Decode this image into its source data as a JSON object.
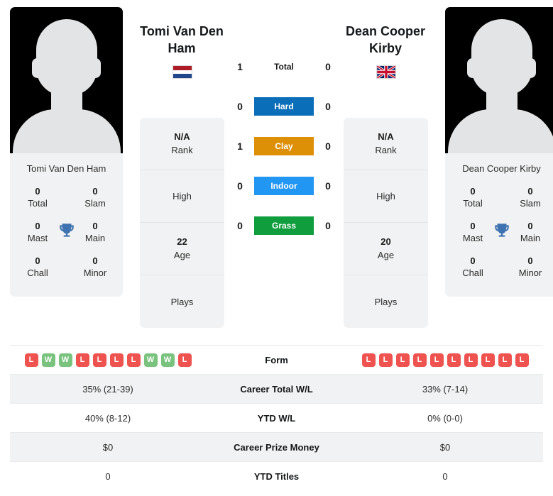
{
  "players": {
    "left": {
      "name": "Tomi Van Den Ham",
      "name_line1": "Tomi Van Den",
      "name_line2": "Ham",
      "photo_caption": "Tomi Van Den Ham",
      "flag": "netherlands-flag",
      "titles": [
        {
          "value": "0",
          "label": "Total"
        },
        {
          "value": "0",
          "label": "Slam"
        },
        {
          "value": "0",
          "label": "Mast"
        },
        {
          "value": "0",
          "label": "Main"
        },
        {
          "value": "0",
          "label": "Chall"
        },
        {
          "value": "0",
          "label": "Minor"
        }
      ],
      "info": [
        {
          "value": "N/A",
          "label": "Rank"
        },
        {
          "value": "",
          "label": "High"
        },
        {
          "value": "22",
          "label": "Age"
        },
        {
          "value": "",
          "label": "Plays"
        }
      ],
      "form": [
        "L",
        "W",
        "W",
        "L",
        "L",
        "L",
        "L",
        "W",
        "W",
        "L"
      ],
      "career_total_wl": "35% (21-39)",
      "ytd_wl": "40% (8-12)",
      "career_prize_money": "$0",
      "ytd_titles": "0"
    },
    "right": {
      "name": "Dean Cooper Kirby",
      "name_line1": "Dean Cooper",
      "name_line2": "Kirby",
      "photo_caption": "Dean Cooper Kirby",
      "flag": "united-kingdom-flag",
      "titles": [
        {
          "value": "0",
          "label": "Total"
        },
        {
          "value": "0",
          "label": "Slam"
        },
        {
          "value": "0",
          "label": "Mast"
        },
        {
          "value": "0",
          "label": "Main"
        },
        {
          "value": "0",
          "label": "Chall"
        },
        {
          "value": "0",
          "label": "Minor"
        }
      ],
      "info": [
        {
          "value": "N/A",
          "label": "Rank"
        },
        {
          "value": "",
          "label": "High"
        },
        {
          "value": "20",
          "label": "Age"
        },
        {
          "value": "",
          "label": "Plays"
        }
      ],
      "form": [
        "L",
        "L",
        "L",
        "L",
        "L",
        "L",
        "L",
        "L",
        "L",
        "L"
      ],
      "career_total_wl": "33% (7-14)",
      "ytd_wl": "0% (0-0)",
      "career_prize_money": "$0",
      "ytd_titles": "0"
    }
  },
  "head_to_head": [
    {
      "label": "Total",
      "left": "1",
      "right": "0",
      "style": "plain",
      "color": ""
    },
    {
      "label": "Hard",
      "left": "0",
      "right": "0",
      "style": "pill",
      "color": "#0b6eb8"
    },
    {
      "label": "Clay",
      "left": "1",
      "right": "0",
      "style": "pill",
      "color": "#dd9006"
    },
    {
      "label": "Indoor",
      "left": "0",
      "right": "0",
      "style": "pill",
      "color": "#2196f3"
    },
    {
      "label": "Grass",
      "left": "0",
      "right": "0",
      "style": "pill",
      "color": "#0f9d3e"
    }
  ],
  "stats_rows": [
    {
      "label": "Form",
      "left": "",
      "right": "",
      "kind": "form"
    },
    {
      "label": "Career Total W/L",
      "left": "35% (21-39)",
      "right": "33% (7-14)",
      "kind": "text"
    },
    {
      "label": "YTD W/L",
      "left": "40% (8-12)",
      "right": "0% (0-0)",
      "kind": "text"
    },
    {
      "label": "Career Prize Money",
      "left": "$0",
      "right": "$0",
      "kind": "text"
    },
    {
      "label": "YTD Titles",
      "left": "0",
      "right": "0",
      "kind": "text"
    }
  ],
  "colors": {
    "win": "#7ac37f",
    "loss": "#ef5350",
    "hard": "#0b6eb8",
    "clay": "#dd9006",
    "indoor": "#2196f3",
    "grass": "#0f9d3e",
    "panel": "#f1f2f3"
  }
}
